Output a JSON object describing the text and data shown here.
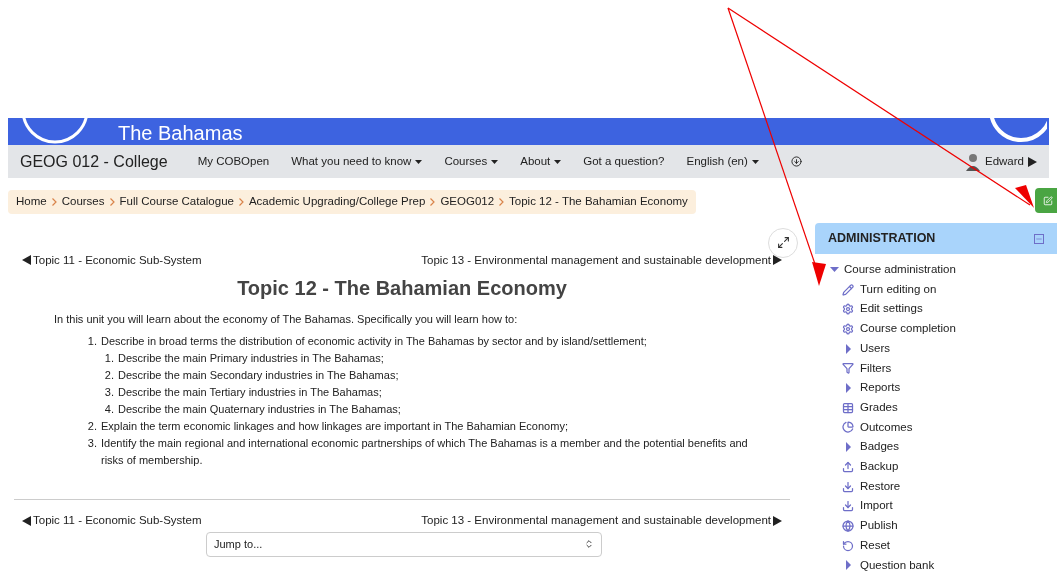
{
  "banner": {
    "title": "The Bahamas"
  },
  "navbar": {
    "brand": "GEOG 012 - College",
    "items": [
      {
        "label": "My COBOpen",
        "dropdown": false
      },
      {
        "label": "What you need to know",
        "dropdown": true
      },
      {
        "label": "Courses",
        "dropdown": true
      },
      {
        "label": "About",
        "dropdown": true
      },
      {
        "label": "Got a question?",
        "dropdown": false
      },
      {
        "label": "English (en)",
        "dropdown": true
      }
    ],
    "user": "Edward"
  },
  "breadcrumb": [
    "Home",
    "Courses",
    "Full Course Catalogue",
    "Academic Upgrading/College Prep",
    "GEOG012",
    "Topic 12 - The Bahamian Economy"
  ],
  "top_nav": {
    "prev": "Topic 11 - Economic Sub-System",
    "next": "Topic 13 - Environmental management and sustainable development"
  },
  "heading": "Topic 12 - The Bahamian Economy",
  "intro": "In this unit you will learn about the economy of The Bahamas. Specifically you will learn how to:",
  "objectives": [
    {
      "number": "1.",
      "text": "Describe in broad terms the distribution of economic activity in The Bahamas by sector and by island/settlement;",
      "children": [
        {
          "number": "1.",
          "text": "Describe the main Primary industries in The Bahamas;"
        },
        {
          "number": "2.",
          "text": "Describe the main Secondary industries in The Bahamas;"
        },
        {
          "number": "3.",
          "text": "Describe the main Tertiary industries in The Bahamas;"
        },
        {
          "number": "4.",
          "text": "Describe the main Quaternary industries in The Bahamas;"
        }
      ]
    },
    {
      "number": "2.",
      "text": "Explain the term economic linkages and how linkages are important in The Bahamian Economy;"
    },
    {
      "number": "3.",
      "text": "Identify the main regional and international economic partnerships of which The Bahamas is a member and the potential benefits and risks of membership."
    }
  ],
  "bottom_nav": {
    "prev": "Topic 11 - Economic Sub-System",
    "next": "Topic 13 - Environmental management and sustainable development"
  },
  "jump": {
    "value": "Jump to..."
  },
  "admin": {
    "title": "ADMINISTRATION",
    "section": {
      "label": "Course administration",
      "expanded": true,
      "items": [
        {
          "label": "Turn editing on",
          "kind": "leaf"
        },
        {
          "label": "Edit settings",
          "kind": "leaf"
        },
        {
          "label": "Course completion",
          "kind": "leaf"
        },
        {
          "label": "Users",
          "kind": "branch"
        },
        {
          "label": "Filters",
          "kind": "leaf"
        },
        {
          "label": "Reports",
          "kind": "branch"
        },
        {
          "label": "Grades",
          "kind": "leaf"
        },
        {
          "label": "Outcomes",
          "kind": "leaf"
        },
        {
          "label": "Badges",
          "kind": "branch"
        },
        {
          "label": "Backup",
          "kind": "leaf"
        },
        {
          "label": "Restore",
          "kind": "leaf"
        },
        {
          "label": "Import",
          "kind": "leaf"
        },
        {
          "label": "Publish",
          "kind": "leaf"
        },
        {
          "label": "Reset",
          "kind": "leaf"
        },
        {
          "label": "Question bank",
          "kind": "branch"
        }
      ]
    }
  }
}
